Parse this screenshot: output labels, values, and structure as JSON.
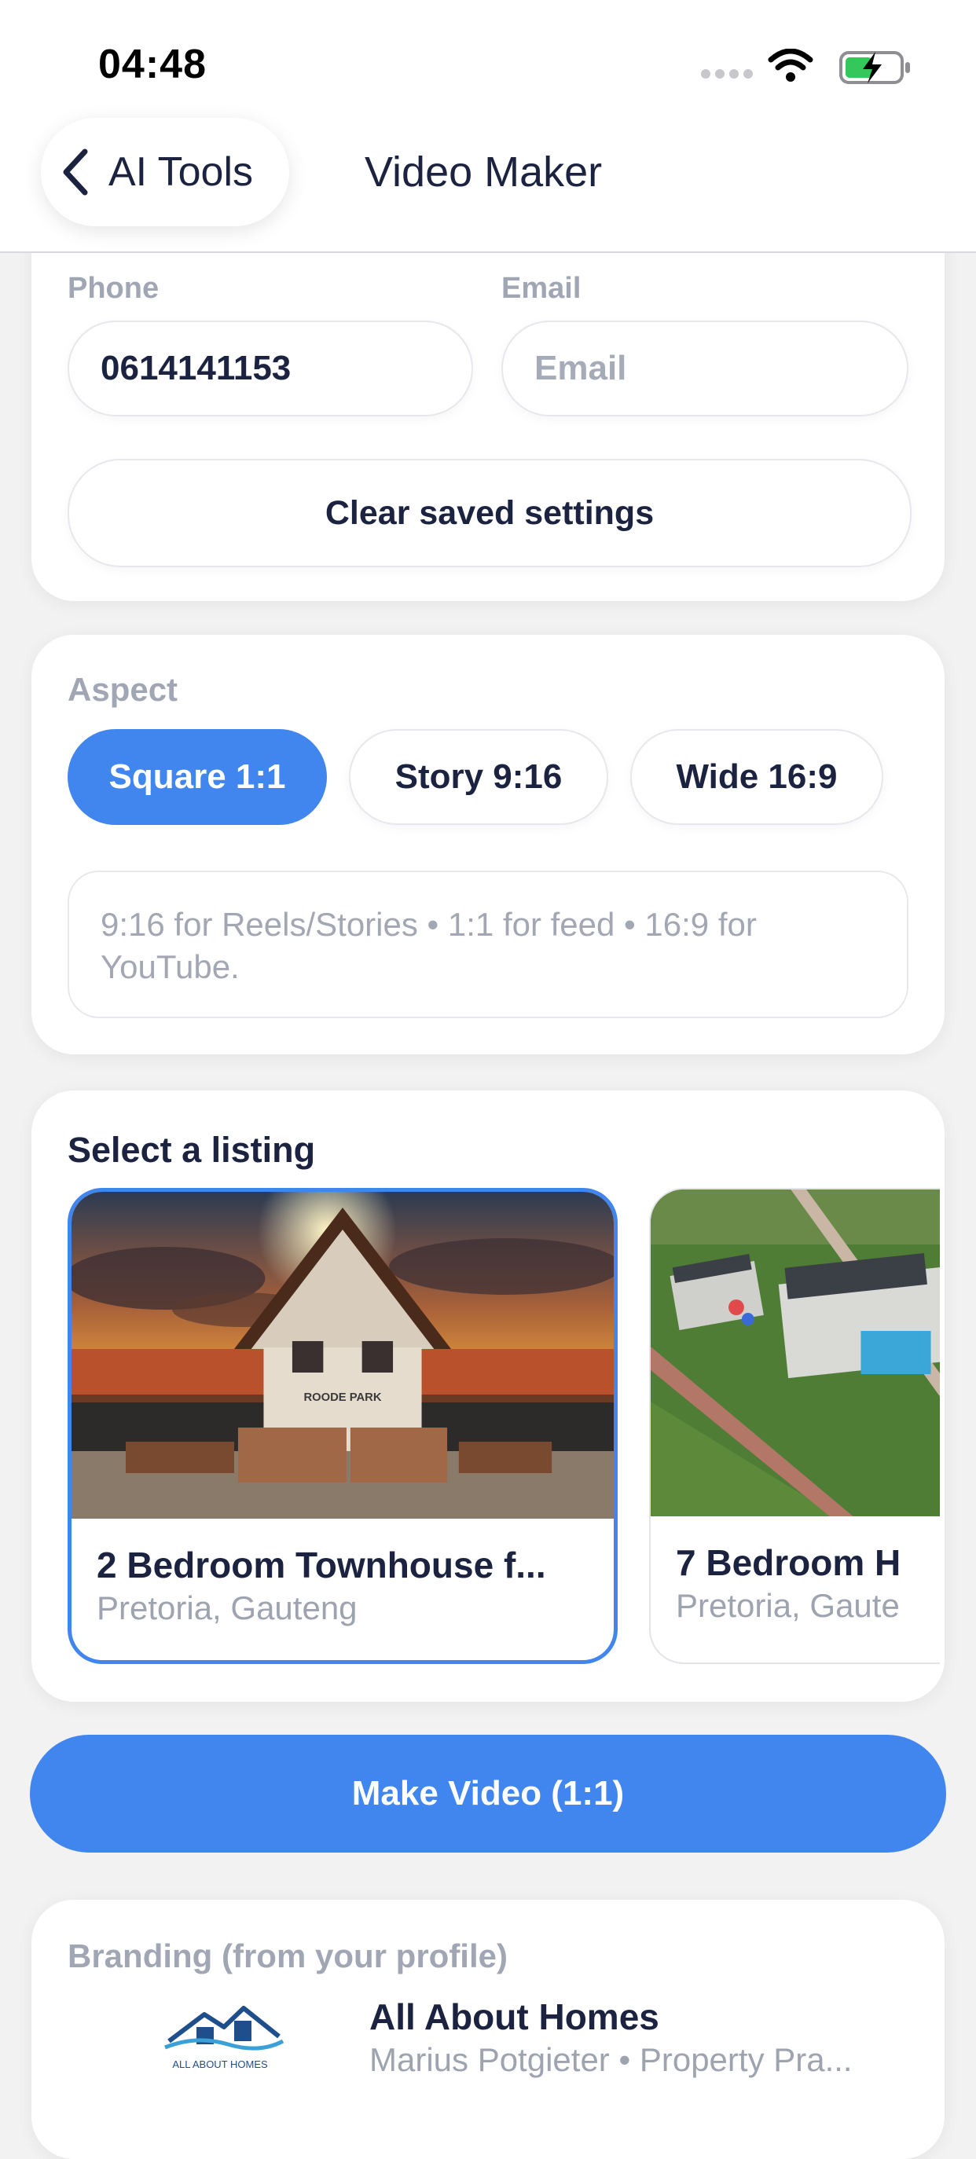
{
  "status_bar": {
    "time": "04:48"
  },
  "nav": {
    "back_label": "AI Tools",
    "title": "Video Maker"
  },
  "contact": {
    "phone_label": "Phone",
    "phone_value": "0614141153",
    "email_label": "Email",
    "email_placeholder": "Email",
    "clear_button": "Clear saved settings"
  },
  "aspect": {
    "label": "Aspect",
    "options": [
      {
        "label": "Square 1:1",
        "selected": true
      },
      {
        "label": "Story 9:16",
        "selected": false
      },
      {
        "label": "Wide 16:9",
        "selected": false
      }
    ],
    "hint": "9:16 for Reels/Stories • 1:1 for feed • 16:9 for YouTube."
  },
  "listings": {
    "title": "Select a listing",
    "items": [
      {
        "title": "2 Bedroom Townhouse f...",
        "location": "Pretoria, Gauteng",
        "selected": true,
        "sign_text": "ROODE PARK"
      },
      {
        "title": "7 Bedroom H",
        "location": "Pretoria, Gaute",
        "selected": false
      }
    ]
  },
  "make_video": {
    "label": "Make Video (1:1)"
  },
  "branding": {
    "label": "Branding (from your profile)",
    "logo_text": "ALL ABOUT HOMES",
    "agency_name": "All About Homes",
    "agent_line": "Marius Potgieter • Property Pra..."
  },
  "colors": {
    "accent": "#4185ef",
    "text": "#1b2340",
    "muted": "#a1a6b4",
    "background": "#f2f2f3"
  }
}
